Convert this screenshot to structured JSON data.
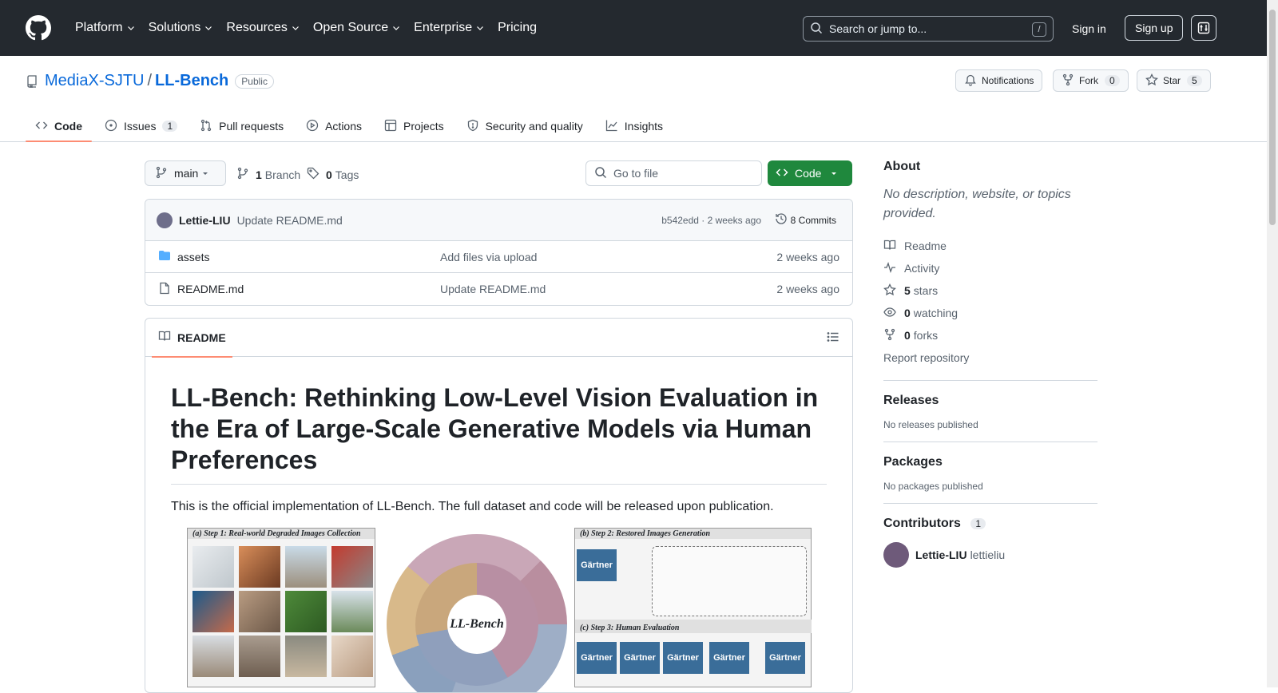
{
  "topnav": {
    "items": [
      {
        "label": "Platform",
        "chevron": true
      },
      {
        "label": "Solutions",
        "chevron": true
      },
      {
        "label": "Resources",
        "chevron": true
      },
      {
        "label": "Open Source",
        "chevron": true
      },
      {
        "label": "Enterprise",
        "chevron": true
      },
      {
        "label": "Pricing",
        "chevron": false
      }
    ],
    "search_placeholder": "Search or jump to...",
    "search_shortcut": "/",
    "signin": "Sign in",
    "signup": "Sign up"
  },
  "repo": {
    "owner": "MediaX-SJTU",
    "separator": "/",
    "name": "LL-Bench",
    "visibility": "Public",
    "notifications": "Notifications",
    "fork_label": "Fork",
    "fork_count": "0",
    "star_label": "Star",
    "star_count": "5"
  },
  "tabs": [
    {
      "label": "Code",
      "count": ""
    },
    {
      "label": "Issues",
      "count": "1"
    },
    {
      "label": "Pull requests",
      "count": ""
    },
    {
      "label": "Actions",
      "count": ""
    },
    {
      "label": "Projects",
      "count": ""
    },
    {
      "label": "Security and quality",
      "count": ""
    },
    {
      "label": "Insights",
      "count": ""
    }
  ],
  "toolbar": {
    "branch": "main",
    "branch_count": "1",
    "branch_label": "Branch",
    "tag_count": "0",
    "tag_label": "Tags",
    "goto_placeholder": "Go to file",
    "code_button": "Code"
  },
  "commit": {
    "author": "Lettie-LIU",
    "message": "Update README.md",
    "hash_time": "b542edd · 2 weeks ago",
    "commits": "8 Commits"
  },
  "files": [
    {
      "name": "assets",
      "type": "folder",
      "message": "Add files via upload",
      "date": "2 weeks ago"
    },
    {
      "name": "README.md",
      "type": "file",
      "message": "Update README.md",
      "date": "2 weeks ago"
    }
  ],
  "readme": {
    "tab": "README",
    "title": "LL-Bench: Rethinking Low-Level Vision Evaluation in the Era of Large-Scale Generative Models via Human Preferences",
    "intro": "This is the official implementation of LL-Bench. The full dataset and code will be released upon publication.",
    "figure": {
      "step1": "(a) Step 1:  Real-world Degraded Images Collection",
      "step2": "(b) Step 2:  Restored Images Generation",
      "step3": "(c) Step 3:  Human Evaluation",
      "wheel_center": "LL-Bench",
      "gartner": "Gärtner"
    }
  },
  "sidebar": {
    "about_title": "About",
    "about_desc": "No description, website, or topics provided.",
    "readme": "Readme",
    "activity": "Activity",
    "stars_count": "5",
    "stars_label": "stars",
    "watching_count": "0",
    "watching_label": "watching",
    "forks_count": "0",
    "forks_label": "forks",
    "report": "Report repository",
    "releases_title": "Releases",
    "releases_text": "No releases published",
    "packages_title": "Packages",
    "packages_text": "No packages published",
    "contributors_title": "Contributors",
    "contributors_count": "1",
    "contributor_name": "Lettie-LIU",
    "contributor_login": "lettieliu"
  }
}
